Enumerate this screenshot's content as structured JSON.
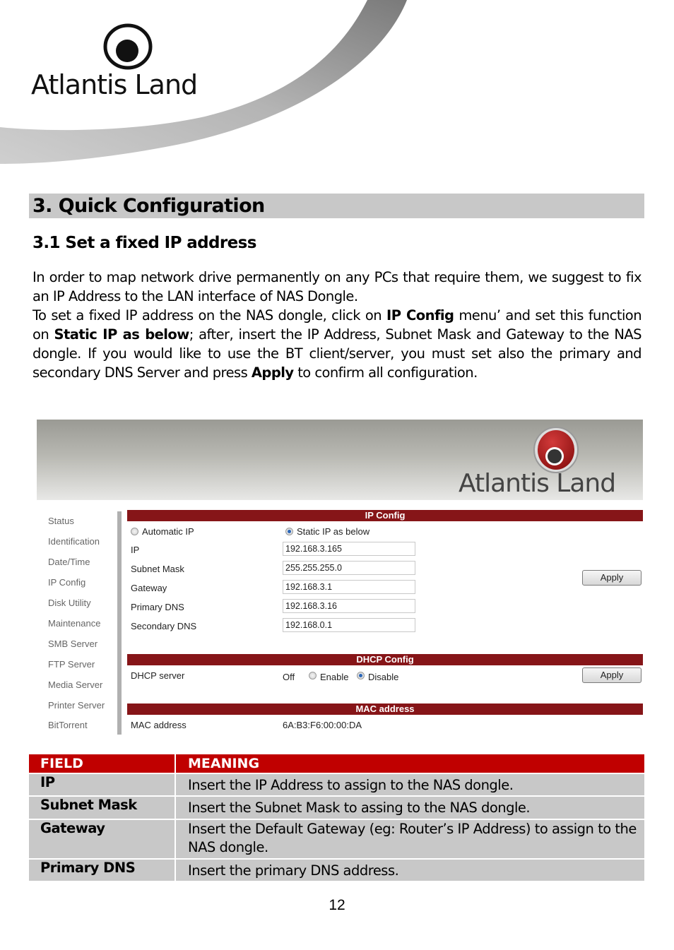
{
  "header": {
    "brand": "Atlantis Land"
  },
  "section": {
    "title": "3. Quick Configuration",
    "subtitle": "3.1 Set a fixed IP address"
  },
  "intro": {
    "p1": "In order to map network drive permanently on any  PCs that require them, we suggest to fix an IP Address to the LAN interface of NAS Dongle.",
    "p2_a": "To set a fixed IP address on the NAS dongle, click on ",
    "p2_b": "IP Config",
    "p2_c": " menu’ and set this function on ",
    "p2_d": "Static IP as below",
    "p2_e": "; after, insert the IP Address, Subnet Mask and Gateway to the NAS dongle. If you would like to use the BT client/server, you must set also the primary and secondary DNS Server and press ",
    "p2_f": "Apply",
    "p2_g": " to confirm all configuration."
  },
  "screenshot": {
    "brand": "Atlantis Land",
    "nav": [
      "Status",
      "Identification",
      "Date/Time",
      "IP Config",
      "Disk Utility",
      "Maintenance",
      "SMB Server",
      "FTP Server",
      "Media Server",
      "Printer Server",
      "BitTorrent"
    ],
    "ip_config": {
      "header": "IP Config",
      "auto_label": "Automatic IP",
      "static_label": "Static IP as below",
      "mode": "static",
      "fields": [
        {
          "label": "IP",
          "value": "192.168.3.165"
        },
        {
          "label": "Subnet Mask",
          "value": "255.255.255.0"
        },
        {
          "label": "Gateway",
          "value": "192.168.3.1"
        },
        {
          "label": "Primary DNS",
          "value": "192.168.3.16"
        },
        {
          "label": "Secondary DNS",
          "value": "192.168.0.1"
        }
      ],
      "apply_label": "Apply"
    },
    "dhcp": {
      "header": "DHCP Config",
      "label": "DHCP server",
      "status": "Off",
      "enable_label": "Enable",
      "disable_label": "Disable",
      "selected": "disable",
      "apply_label": "Apply"
    },
    "mac": {
      "header": "MAC address",
      "label": "MAC address",
      "value": "6A:B3:F6:00:00:DA"
    }
  },
  "table": {
    "headers": [
      "FIELD",
      "MEANING"
    ],
    "rows": [
      {
        "field": "IP",
        "meaning": "Insert the IP Address to assign to the NAS dongle."
      },
      {
        "field": "Subnet Mask",
        "meaning": "Insert the Subnet Mask to assing to the NAS dongle."
      },
      {
        "field": "Gateway",
        "meaning": "Insert the Default Gateway (eg: Router’s IP Address) to assign to the NAS dongle."
      },
      {
        "field": "Primary DNS",
        "meaning": "Insert the primary DNS address."
      }
    ]
  },
  "colors": {
    "heading_bar": "#c8c8c8",
    "table_header": "#c00000",
    "table_cell": "#c8c8c8",
    "section_bar": "#861518"
  },
  "page_number": "12"
}
